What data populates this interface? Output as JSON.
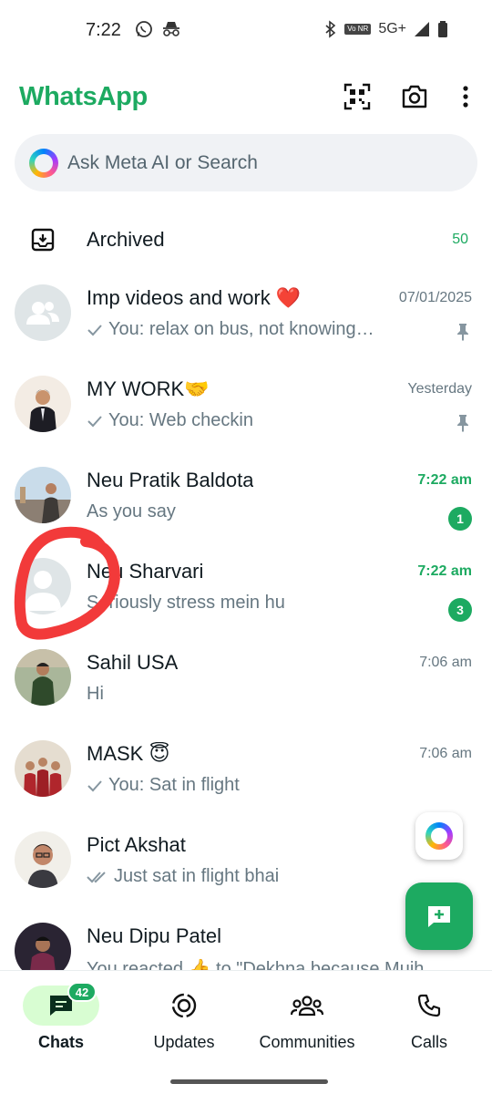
{
  "status_bar": {
    "time": "7:22",
    "network": "5G+",
    "volte": "Vo NR"
  },
  "header": {
    "title": "WhatsApp"
  },
  "search": {
    "placeholder": "Ask Meta AI or Search"
  },
  "archived": {
    "label": "Archived",
    "count": "50"
  },
  "chats": [
    {
      "name": "Imp videos and work ❤️",
      "time": "07/01/2025",
      "time_unread": false,
      "preview": "You: relax on bus, not knowing…",
      "check": "single",
      "pinned": true,
      "unread": "",
      "avatar": "group-placeholder"
    },
    {
      "name": "MY WORK🤝",
      "time": "Yesterday",
      "time_unread": false,
      "preview": "You: Web checkin",
      "check": "single",
      "pinned": true,
      "unread": "",
      "avatar": "photo"
    },
    {
      "name": "Neu Pratik Baldota",
      "time": "7:22 am",
      "time_unread": true,
      "preview": "As you say",
      "check": "none",
      "pinned": false,
      "unread": "1",
      "avatar": "photo"
    },
    {
      "name": "Neu Sharvari",
      "time": "7:22 am",
      "time_unread": true,
      "preview": "Seriously stress mein hu",
      "check": "none",
      "pinned": false,
      "unread": "3",
      "avatar": "person-placeholder"
    },
    {
      "name": "Sahil USA",
      "time": "7:06 am",
      "time_unread": false,
      "preview": "Hi",
      "check": "none",
      "pinned": false,
      "unread": "",
      "avatar": "photo"
    },
    {
      "name": "MASK 😇",
      "time": "7:06 am",
      "time_unread": false,
      "preview": "You: Sat in flight",
      "check": "single",
      "pinned": false,
      "unread": "",
      "avatar": "photo"
    },
    {
      "name": "Pict Akshat",
      "time": "",
      "time_unread": false,
      "preview": "Just sat in flight bhai",
      "check": "double",
      "pinned": false,
      "unread": "",
      "avatar": "photo"
    },
    {
      "name": "Neu Dipu Patel",
      "time": "",
      "time_unread": false,
      "preview": "You reacted 👍 to \"Dekhna because Mujh",
      "check": "none",
      "pinned": false,
      "unread": "",
      "avatar": "photo"
    }
  ],
  "bottom_nav": {
    "items": [
      {
        "label": "Chats",
        "active": true,
        "badge": "42"
      },
      {
        "label": "Updates",
        "active": false,
        "badge": ""
      },
      {
        "label": "Communities",
        "active": false,
        "badge": ""
      },
      {
        "label": "Calls",
        "active": false,
        "badge": ""
      }
    ]
  },
  "colors": {
    "accent": "#1daa61",
    "active_nav_bg": "#d8fdd2",
    "annotation": "#f23a3a"
  }
}
